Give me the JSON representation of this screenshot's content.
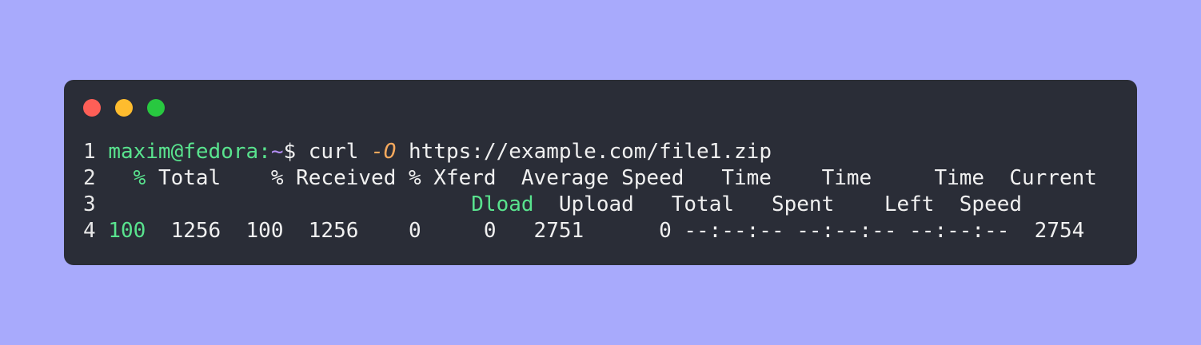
{
  "window": {
    "buttons": {
      "close_color": "#fe5f57",
      "minimize_color": "#febc2e",
      "maximize_color": "#28c840"
    }
  },
  "terminal": {
    "lines": [
      {
        "number": "1",
        "prompt_user": "maxim@fedora:",
        "prompt_path": "~",
        "prompt_symbol": "$",
        "command": "curl",
        "flag": "-O",
        "url": "https://example.com/file1.zip"
      },
      {
        "number": "2",
        "pct1": "%",
        "text": "Total    % Received % Xferd  Average Speed   Time    Time     Time  Current"
      },
      {
        "number": "3",
        "dload": "Dload",
        "text": "Upload   Total   Spent    Left  Speed"
      },
      {
        "number": "4",
        "pct_value": "100",
        "text": "1256  100  1256    0     0   2751      0 --:--:-- --:--:-- --:--:--  2754"
      }
    ]
  }
}
